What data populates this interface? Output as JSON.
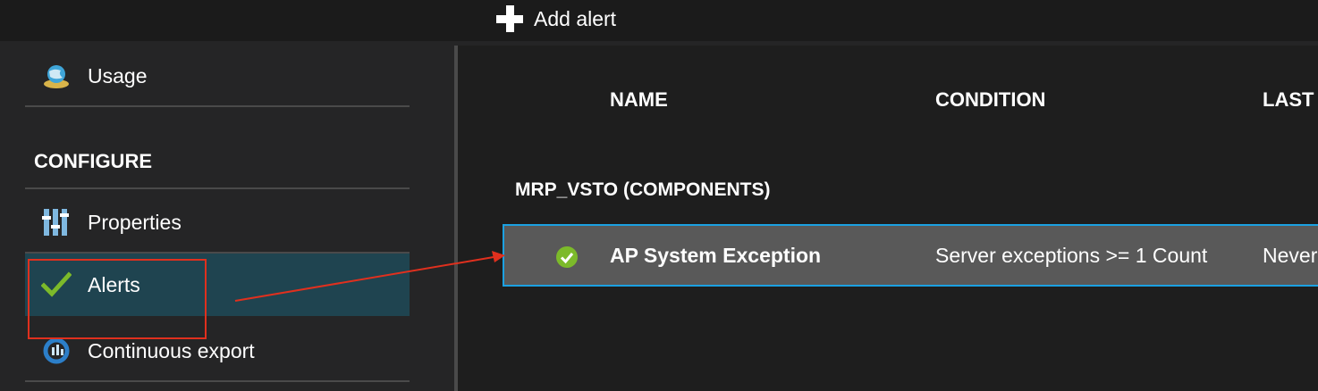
{
  "toolbar": {
    "add_alert_label": "Add alert",
    "add_alert_icon": "plus-icon"
  },
  "sidebar": {
    "items_top": [
      {
        "label": "Usage",
        "icon": "globe-usage-icon"
      }
    ],
    "section_heading": "CONFIGURE",
    "items": [
      {
        "label": "Properties",
        "icon": "properties-bars-icon"
      },
      {
        "label": "Alerts",
        "icon": "checkmark-icon",
        "selected": true
      },
      {
        "label": "Continuous export",
        "icon": "export-icon"
      }
    ]
  },
  "alerts_table": {
    "columns": [
      "NAME",
      "CONDITION",
      "LAST"
    ],
    "groups": [
      {
        "title": "MRP_VSTO (COMPONENTS)",
        "rows": [
          {
            "status_icon": "check-circle-icon",
            "name": "AP System Exception",
            "condition": "Server exceptions >= 1 Count",
            "last": "Never"
          }
        ]
      }
    ]
  },
  "colors": {
    "selected_bg": "#1f4450",
    "row_bg": "#595959",
    "row_border": "#1ba1e2",
    "success_green": "#7cba2a",
    "annotation_red": "#e0301e"
  }
}
